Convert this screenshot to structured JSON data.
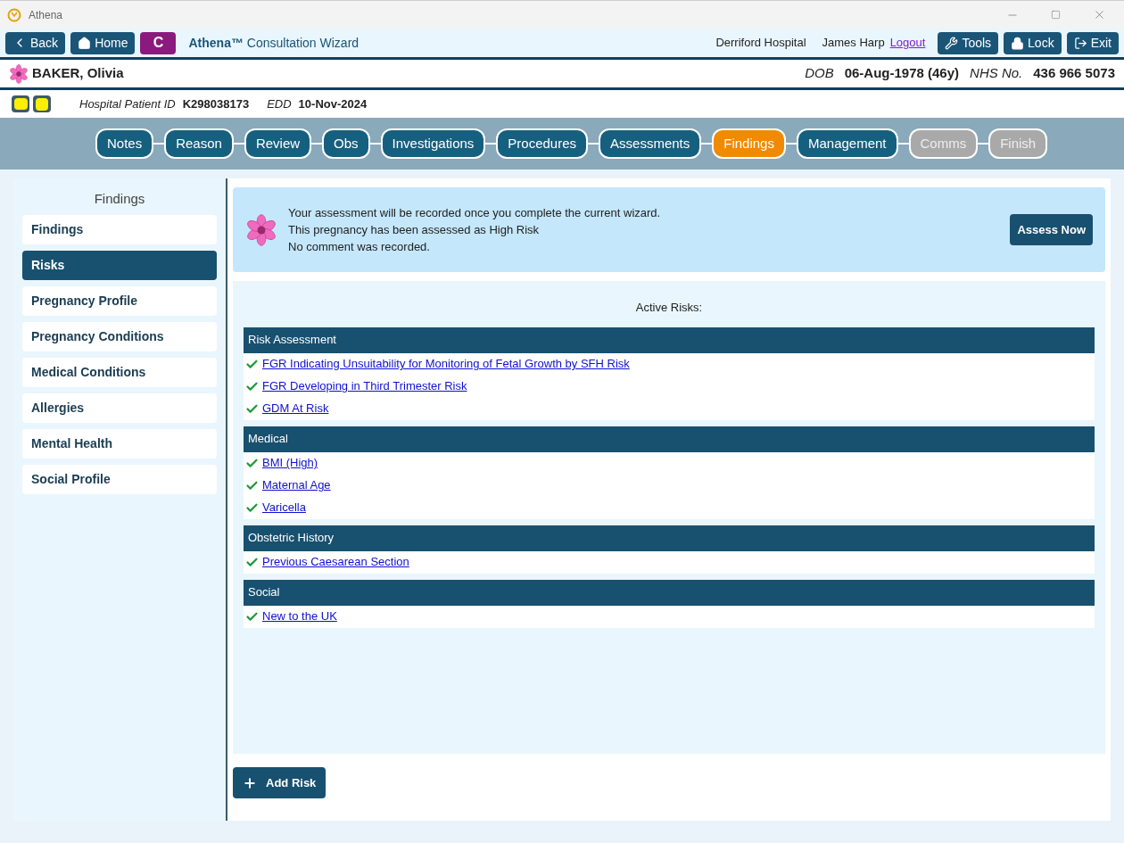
{
  "window": {
    "title": "Athena"
  },
  "toolbar": {
    "back": "Back",
    "home": "Home",
    "badge": "C",
    "app_name": "Athena™",
    "app_subtitle": "Consultation Wizard",
    "hospital": "Derriford Hospital",
    "user": "James Harp",
    "logout": "Logout",
    "tools": "Tools",
    "lock": "Lock",
    "exit": "Exit"
  },
  "patient": {
    "name": "BAKER, Olivia",
    "dob_label": "DOB",
    "dob": "06-Aug-1978 (46y)",
    "nhs_label": "NHS No.",
    "nhs": "436 966 5073",
    "id_label": "Hospital Patient ID",
    "id": "K298038173",
    "edd_label": "EDD",
    "edd": "10-Nov-2024"
  },
  "wizard_steps": [
    {
      "label": "Notes",
      "selected": false,
      "disabled": false
    },
    {
      "label": "Reason",
      "selected": false,
      "disabled": false
    },
    {
      "label": "Review",
      "selected": false,
      "disabled": false
    },
    {
      "label": "Obs",
      "selected": false,
      "disabled": false
    },
    {
      "label": "Investigations",
      "selected": false,
      "disabled": false
    },
    {
      "label": "Procedures",
      "selected": false,
      "disabled": false
    },
    {
      "label": "Assessments",
      "selected": false,
      "disabled": false
    },
    {
      "label": "Findings",
      "selected": true,
      "disabled": false
    },
    {
      "label": "Management",
      "selected": false,
      "disabled": false
    },
    {
      "label": "Comms",
      "selected": false,
      "disabled": true
    },
    {
      "label": "Finish",
      "selected": false,
      "disabled": true
    }
  ],
  "sidebar": {
    "title": "Findings",
    "items": [
      {
        "label": "Findings",
        "selected": false
      },
      {
        "label": "Risks",
        "selected": true
      },
      {
        "label": "Pregnancy Profile",
        "selected": false
      },
      {
        "label": "Pregnancy Conditions",
        "selected": false
      },
      {
        "label": "Medical Conditions",
        "selected": false
      },
      {
        "label": "Allergies",
        "selected": false
      },
      {
        "label": "Mental Health",
        "selected": false
      },
      {
        "label": "Social Profile",
        "selected": false
      }
    ]
  },
  "notice": {
    "lines": [
      "Your assessment will be recorded once you complete the current wizard.",
      "This pregnancy has been assessed as High Risk",
      "No comment was recorded."
    ],
    "button": "Assess Now"
  },
  "risks": {
    "title": "Active Risks:",
    "groups": [
      {
        "heading": "Risk Assessment",
        "items": [
          "FGR Indicating Unsuitability for Monitoring of Fetal Growth by SFH Risk",
          "FGR Developing in Third Trimester Risk",
          "GDM At Risk"
        ]
      },
      {
        "heading": "Medical",
        "items": [
          "BMI (High)",
          "Maternal Age",
          "Varicella"
        ]
      },
      {
        "heading": "Obstetric History",
        "items": [
          "Previous Caesarean Section"
        ]
      },
      {
        "heading": "Social",
        "items": [
          "New to the UK"
        ]
      }
    ]
  },
  "add_button": "Add Risk"
}
